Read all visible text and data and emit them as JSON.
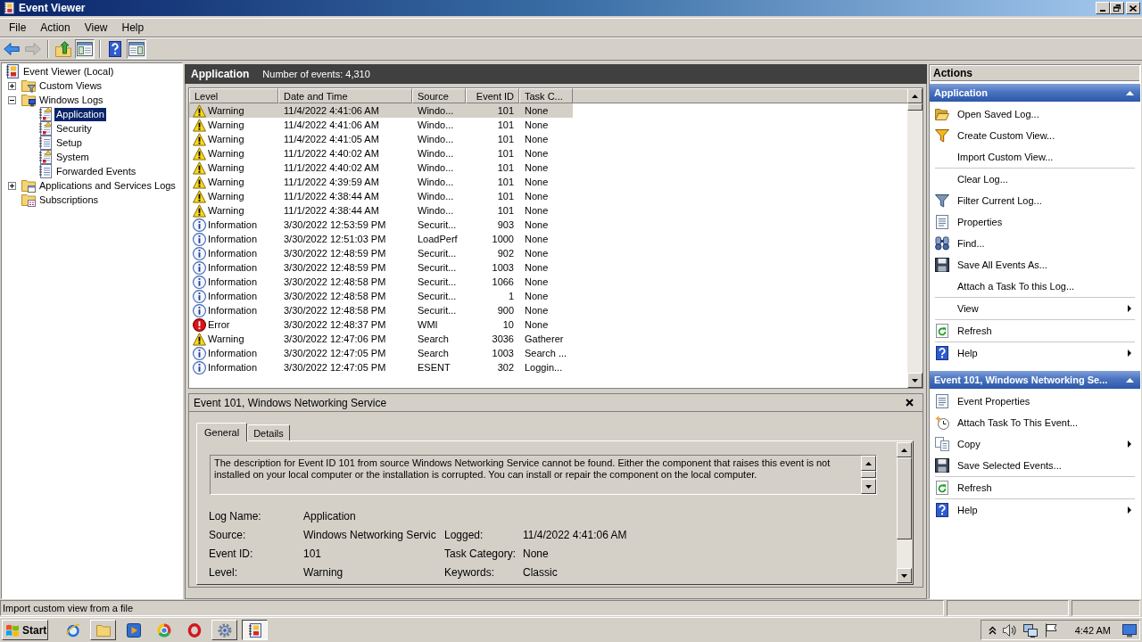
{
  "window": {
    "title": "Event Viewer"
  },
  "menu": [
    {
      "label": "File"
    },
    {
      "label": "Action"
    },
    {
      "label": "View"
    },
    {
      "label": "Help"
    }
  ],
  "toolbar": {
    "groups": [
      {
        "buttons": [
          {
            "kind": "back",
            "disabled": false,
            "pressed": false
          },
          {
            "kind": "forward",
            "disabled": true,
            "pressed": false
          }
        ]
      },
      {
        "buttons": [
          {
            "kind": "up",
            "disabled": false,
            "pressed": false
          },
          {
            "kind": "console-tree",
            "disabled": false,
            "pressed": true
          }
        ]
      },
      {
        "buttons": [
          {
            "kind": "help",
            "disabled": false,
            "pressed": false
          },
          {
            "kind": "action-pane",
            "disabled": false,
            "pressed": true
          }
        ]
      }
    ]
  },
  "tree": [
    {
      "label": "Event Viewer (Local)",
      "kind": "root",
      "selected": false,
      "children": [
        {
          "label": "Custom Views",
          "kind": "filter-folder",
          "expanded": false,
          "selected": false
        },
        {
          "label": "Windows Logs",
          "kind": "logs-folder",
          "expanded": true,
          "selected": false,
          "children": [
            {
              "label": "Application",
              "kind": "alert-log",
              "selected": true
            },
            {
              "label": "Security",
              "kind": "alert-log",
              "selected": false
            },
            {
              "label": "Setup",
              "kind": "log",
              "selected": false
            },
            {
              "label": "System",
              "kind": "alert-log",
              "selected": false
            },
            {
              "label": "Forwarded Events",
              "kind": "log",
              "selected": false
            }
          ]
        },
        {
          "label": "Applications and Services Logs",
          "kind": "app-folder",
          "expanded": false,
          "selected": false
        },
        {
          "label": "Subscriptions",
          "kind": "subscriptions",
          "selected": false
        }
      ]
    }
  ],
  "content_header": {
    "title": "Application",
    "summary": "Number of events: 4,310"
  },
  "events": {
    "columns": [
      {
        "label": "Level"
      },
      {
        "label": "Date and Time"
      },
      {
        "label": "Source"
      },
      {
        "label": "Event ID"
      },
      {
        "label": "Task C..."
      }
    ],
    "rows": [
      {
        "severity": "Warning",
        "kind": "warning",
        "date": "11/4/2022 4:41:06 AM",
        "source": "Windo...",
        "event_id": "101",
        "task": "None",
        "selected": true
      },
      {
        "severity": "Warning",
        "kind": "warning",
        "date": "11/4/2022 4:41:06 AM",
        "source": "Windo...",
        "event_id": "101",
        "task": "None",
        "selected": false
      },
      {
        "severity": "Warning",
        "kind": "warning",
        "date": "11/4/2022 4:41:05 AM",
        "source": "Windo...",
        "event_id": "101",
        "task": "None",
        "selected": false
      },
      {
        "severity": "Warning",
        "kind": "warning",
        "date": "11/1/2022 4:40:02 AM",
        "source": "Windo...",
        "event_id": "101",
        "task": "None",
        "selected": false
      },
      {
        "severity": "Warning",
        "kind": "warning",
        "date": "11/1/2022 4:40:02 AM",
        "source": "Windo...",
        "event_id": "101",
        "task": "None",
        "selected": false
      },
      {
        "severity": "Warning",
        "kind": "warning",
        "date": "11/1/2022 4:39:59 AM",
        "source": "Windo...",
        "event_id": "101",
        "task": "None",
        "selected": false
      },
      {
        "severity": "Warning",
        "kind": "warning",
        "date": "11/1/2022 4:38:44 AM",
        "source": "Windo...",
        "event_id": "101",
        "task": "None",
        "selected": false
      },
      {
        "severity": "Warning",
        "kind": "warning",
        "date": "11/1/2022 4:38:44 AM",
        "source": "Windo...",
        "event_id": "101",
        "task": "None",
        "selected": false
      },
      {
        "severity": "Information",
        "kind": "information",
        "date": "3/30/2022 12:53:59 PM",
        "source": "Securit...",
        "event_id": "903",
        "task": "None",
        "selected": false
      },
      {
        "severity": "Information",
        "kind": "information",
        "date": "3/30/2022 12:51:03 PM",
        "source": "LoadPerf",
        "event_id": "1000",
        "task": "None",
        "selected": false
      },
      {
        "severity": "Information",
        "kind": "information",
        "date": "3/30/2022 12:48:59 PM",
        "source": "Securit...",
        "event_id": "902",
        "task": "None",
        "selected": false
      },
      {
        "severity": "Information",
        "kind": "information",
        "date": "3/30/2022 12:48:59 PM",
        "source": "Securit...",
        "event_id": "1003",
        "task": "None",
        "selected": false
      },
      {
        "severity": "Information",
        "kind": "information",
        "date": "3/30/2022 12:48:58 PM",
        "source": "Securit...",
        "event_id": "1066",
        "task": "None",
        "selected": false
      },
      {
        "severity": "Information",
        "kind": "information",
        "date": "3/30/2022 12:48:58 PM",
        "source": "Securit...",
        "event_id": "1",
        "task": "None",
        "selected": false
      },
      {
        "severity": "Information",
        "kind": "information",
        "date": "3/30/2022 12:48:58 PM",
        "source": "Securit...",
        "event_id": "900",
        "task": "None",
        "selected": false
      },
      {
        "severity": "Error",
        "kind": "error",
        "date": "3/30/2022 12:48:37 PM",
        "source": "WMI",
        "event_id": "10",
        "task": "None",
        "selected": false
      },
      {
        "severity": "Warning",
        "kind": "warning",
        "date": "3/30/2022 12:47:06 PM",
        "source": "Search",
        "event_id": "3036",
        "task": "Gatherer",
        "selected": false
      },
      {
        "severity": "Information",
        "kind": "information",
        "date": "3/30/2022 12:47:05 PM",
        "source": "Search",
        "event_id": "1003",
        "task": "Search ...",
        "selected": false
      },
      {
        "severity": "Information",
        "kind": "information",
        "date": "3/30/2022 12:47:05 PM",
        "source": "ESENT",
        "event_id": "302",
        "task": "Loggin...",
        "selected": false
      }
    ]
  },
  "detail": {
    "title": "Event 101, Windows Networking Service",
    "tabs": [
      {
        "label": "General",
        "selected": true
      },
      {
        "label": "Details",
        "selected": false
      }
    ],
    "description": "The description for Event ID 101 from source Windows Networking Service cannot be found. Either the component that raises this event is not installed on your local computer or the installation is corrupted. You can install or repair the component on the local computer.",
    "field_rows": [
      [
        {
          "label": "Log Name:",
          "value": "Application"
        }
      ],
      [
        {
          "label": "Source:",
          "value": "Windows Networking Servic"
        },
        {
          "label": "Logged:",
          "value": "11/4/2022 4:41:06 AM"
        }
      ],
      [
        {
          "label": "Event ID:",
          "value": "101"
        },
        {
          "label": "Task Category:",
          "value": "None"
        }
      ],
      [
        {
          "label": "Level:",
          "value": "Warning"
        },
        {
          "label": "Keywords:",
          "value": "Classic"
        }
      ]
    ]
  },
  "actions": {
    "title": "Actions",
    "sections": [
      {
        "title": "Application",
        "expanded": true,
        "groups": [
          {
            "items": [
              {
                "label": "Open Saved Log...",
                "kind": "open-log",
                "submenu": false
              },
              {
                "label": "Create Custom View...",
                "kind": "new-filter",
                "submenu": false
              },
              {
                "label": "Import Custom View...",
                "kind": "none",
                "submenu": false
              }
            ]
          },
          {
            "items": [
              {
                "label": "Clear Log...",
                "kind": "none",
                "submenu": false
              },
              {
                "label": "Filter Current Log...",
                "kind": "filter",
                "submenu": false
              },
              {
                "label": "Properties",
                "kind": "properties",
                "submenu": false
              },
              {
                "label": "Find...",
                "kind": "find",
                "submenu": false
              },
              {
                "label": "Save All Events As...",
                "kind": "save",
                "submenu": false
              },
              {
                "label": "Attach a Task To this Log...",
                "kind": "none",
                "submenu": false
              }
            ]
          },
          {
            "items": [
              {
                "label": "View",
                "kind": "none",
                "submenu": true
              }
            ]
          },
          {
            "items": [
              {
                "label": "Refresh",
                "kind": "refresh",
                "submenu": false
              }
            ]
          },
          {
            "items": [
              {
                "label": "Help",
                "kind": "help",
                "submenu": true
              }
            ]
          }
        ]
      },
      {
        "title": "Event 101, Windows Networking Se...",
        "expanded": true,
        "groups": [
          {
            "items": [
              {
                "label": "Event Properties",
                "kind": "properties",
                "submenu": false
              },
              {
                "label": "Attach Task To This Event...",
                "kind": "task",
                "submenu": false
              },
              {
                "label": "Copy",
                "kind": "copy",
                "submenu": true
              },
              {
                "label": "Save Selected Events...",
                "kind": "save",
                "submenu": false
              }
            ]
          },
          {
            "items": [
              {
                "label": "Refresh",
                "kind": "refresh",
                "submenu": false
              }
            ]
          },
          {
            "items": [
              {
                "label": "Help",
                "kind": "help",
                "submenu": true
              }
            ]
          }
        ]
      }
    ]
  },
  "status_bar": {
    "text": "Import custom view from a file"
  },
  "taskbar": {
    "start": "Start",
    "buttons": [
      {
        "kind": "e-globe",
        "open": false,
        "selected": false
      },
      {
        "kind": "folder",
        "open": true,
        "selected": false
      },
      {
        "kind": "play",
        "open": false,
        "selected": false
      },
      {
        "kind": "tricolor",
        "open": false,
        "selected": false
      },
      {
        "kind": "red-ring",
        "open": false,
        "selected": false
      },
      {
        "kind": "gear",
        "open": true,
        "selected": false
      },
      {
        "kind": "log",
        "open": true,
        "selected": true
      }
    ],
    "clock": "4:42 AM"
  }
}
